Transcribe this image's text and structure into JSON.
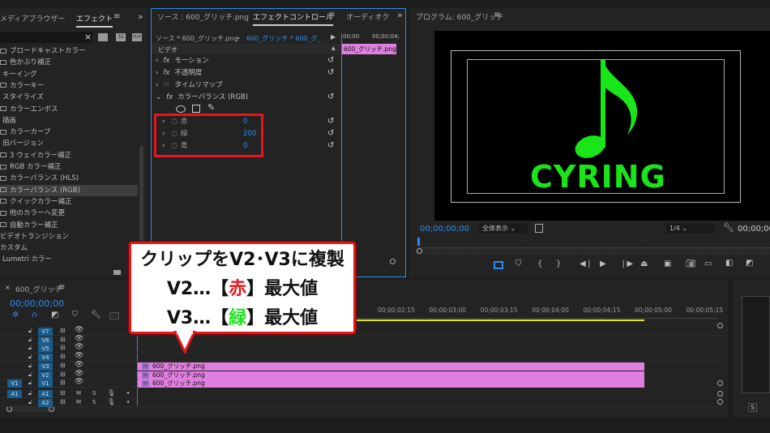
{
  "effects_panel": {
    "tabs": [
      "メディアブラウザー",
      "エフェクト"
    ],
    "search_clear": "×",
    "icons": [
      "accelerated-effects-icon",
      "32bit-icon",
      "yuv-icon"
    ],
    "icon_labels": [
      "32",
      "YUV"
    ],
    "items": [
      {
        "label": "ブロードキャストカラー",
        "type": "effect"
      },
      {
        "label": "色かぶり補正",
        "type": "effect"
      },
      {
        "label": "キーイング",
        "type": "folder"
      },
      {
        "label": "カラーキー",
        "type": "effect"
      },
      {
        "label": "スタイライズ",
        "type": "folder"
      },
      {
        "label": "カラーエンボス",
        "type": "effect"
      },
      {
        "label": "描画",
        "type": "folder"
      },
      {
        "label": "カラーカーブ",
        "type": "effect"
      },
      {
        "label": "旧バージョン",
        "type": "folder"
      },
      {
        "label": "3 ウェイカラー補正",
        "type": "effect"
      },
      {
        "label": "RGB カラー補正",
        "type": "effect"
      },
      {
        "label": "カラーバランス (HLS)",
        "type": "effect"
      },
      {
        "label": "カラーバランス (RGB)",
        "type": "effect",
        "selected": true
      },
      {
        "label": "クイックカラー補正",
        "type": "effect"
      },
      {
        "label": "他のカラーへ変更",
        "type": "effect"
      },
      {
        "label": "自動カラー補正",
        "type": "effect"
      },
      {
        "label": "ビデオトランジション",
        "type": "category"
      },
      {
        "label": "カスタム",
        "type": "category"
      },
      {
        "label": "Lumetri カラー",
        "type": "folder"
      }
    ]
  },
  "effect_controls": {
    "tabs": [
      "ソース : 600_グリッチ.png",
      "エフェクトコントロール",
      "オーディオク"
    ],
    "source": "ソース * 600_グリッチ.png",
    "sequence": "600_グリッチ * 600_グ_",
    "time_start": "00;00",
    "time_end": "00;00;04;",
    "clip_name": "600_グリッチ.png",
    "section": "ビデオ",
    "effects": [
      {
        "name": "モーション"
      },
      {
        "name": "不透明度"
      },
      {
        "name": "タイムリマップ",
        "disabled": true
      },
      {
        "name": "カラーバランス (RGB)",
        "expanded": true
      }
    ],
    "params": [
      {
        "name": "赤",
        "value": "0"
      },
      {
        "name": "緑",
        "value": "200"
      },
      {
        "name": "青",
        "value": "0"
      }
    ]
  },
  "program": {
    "title": "プログラム: 600_グリッチ",
    "timecode": "00;00;00;00",
    "zoom": "全体表示",
    "resolution": "1/4",
    "timecode_right": "00;00;00",
    "video_text": "CYRING",
    "accent": "#19e619"
  },
  "timeline": {
    "title": "600_グリッチ",
    "timecode": "00;00;00;00",
    "ruler": [
      "00;00;02;15",
      "00;00;03;00",
      "00;00;03;15",
      "00;00;04;00",
      "00;00;04;15",
      "00;00;05;00",
      "00;00;05;15"
    ],
    "video_tracks": [
      "V7",
      "V6",
      "V5",
      "V4",
      "V3",
      "V2",
      "V1"
    ],
    "source_patch_v": "V1",
    "audio_tracks": [
      "A1",
      "A2"
    ],
    "source_patch_a": "A1",
    "mute": "M",
    "solo": "S",
    "cc": "CC",
    "clips": [
      {
        "track": "V3",
        "name": "600_グリッチ.png"
      },
      {
        "track": "V2",
        "name": "600_グリッチ.png"
      },
      {
        "track": "V1",
        "name": "600_グリッチ.png"
      }
    ]
  },
  "right_panel": {
    "solo": "S"
  },
  "callout": {
    "line1": "クリップをV2･V3に複製",
    "line2_pre": "V2…【",
    "line2_hl": "赤",
    "line2_post": "】最大値",
    "line3_pre": "V3…【",
    "line3_hl": "緑",
    "line3_post": "】最大値",
    "red": "#e8161b",
    "green": "#19e619"
  }
}
